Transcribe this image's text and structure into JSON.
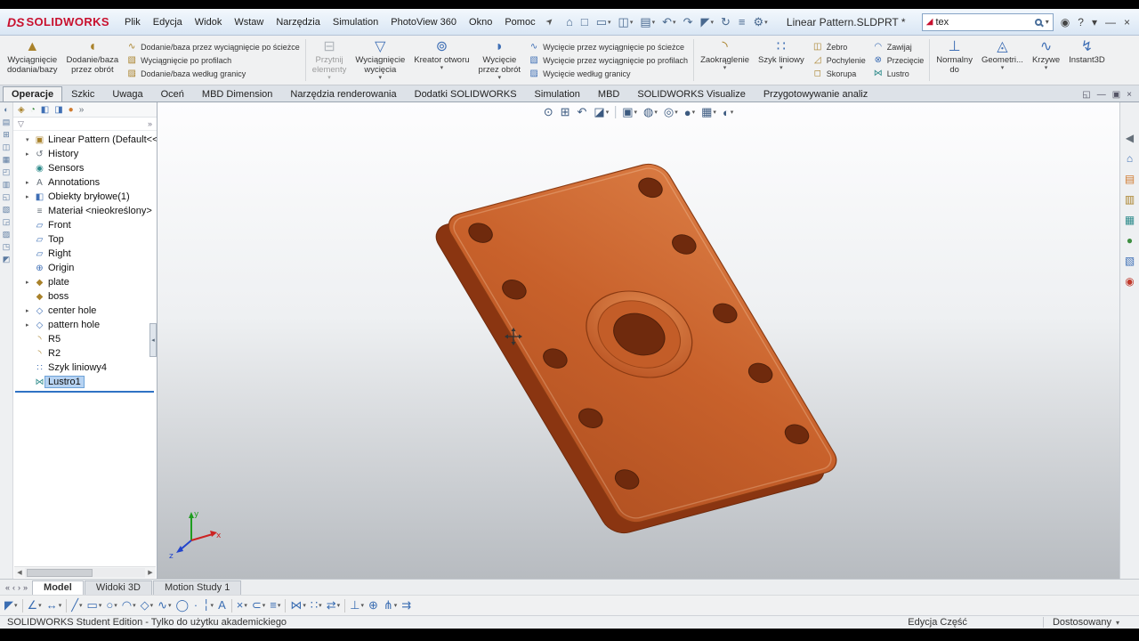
{
  "chrome": {
    "logo_mark": "DS",
    "brand": "SOLIDWORKS",
    "title": "Linear Pattern.SLDPRT *",
    "pin_glyph": "➤",
    "menus": [
      {
        "name": "menu-plik",
        "label": "Plik"
      },
      {
        "name": "menu-edycja",
        "label": "Edycja"
      },
      {
        "name": "menu-widok",
        "label": "Widok"
      },
      {
        "name": "menu-wstaw",
        "label": "Wstaw"
      },
      {
        "name": "menu-narzedzia",
        "label": "Narzędzia"
      },
      {
        "name": "menu-simulation",
        "label": "Simulation"
      },
      {
        "name": "menu-photoview-360",
        "label": "PhotoView 360"
      },
      {
        "name": "menu-okno",
        "label": "Okno"
      },
      {
        "name": "menu-pomoc",
        "label": "Pomoc"
      }
    ],
    "quickbar": [
      {
        "name": "home-icon",
        "glyph": "⌂",
        "drop": ""
      },
      {
        "name": "new-document-icon",
        "glyph": "□",
        "drop": ""
      },
      {
        "name": "open-icon",
        "glyph": "▭",
        "drop": "▾"
      },
      {
        "name": "save-icon",
        "glyph": "◫",
        "drop": "▾"
      },
      {
        "name": "print-icon",
        "glyph": "▤",
        "drop": "▾"
      },
      {
        "name": "undo-icon",
        "glyph": "↶",
        "drop": "▾"
      },
      {
        "name": "redo-icon",
        "glyph": "↷",
        "drop": ""
      },
      {
        "name": "select-icon",
        "glyph": "◤",
        "drop": "▾"
      },
      {
        "name": "rebuild-icon",
        "glyph": "↻",
        "drop": ""
      },
      {
        "name": "file-properties-icon",
        "glyph": "≡",
        "drop": ""
      },
      {
        "name": "options-icon",
        "glyph": "⚙",
        "drop": "▾"
      }
    ],
    "search": {
      "value": "tex",
      "logo_glyph": "◢",
      "drop_glyph": "▾"
    },
    "window_icons": [
      {
        "name": "account-icon",
        "glyph": "◉"
      },
      {
        "name": "help-icon",
        "glyph": "?"
      },
      {
        "name": "help-dropdown-icon",
        "glyph": "▾"
      },
      {
        "name": "minimize-icon",
        "glyph": "—"
      },
      {
        "name": "close-icon",
        "glyph": "×"
      }
    ]
  },
  "ribbon": {
    "b1": {
      "label1": "Wyciągnięcie",
      "label2": "dodania/bazy",
      "icon": "▲",
      "drop": ""
    },
    "b2": {
      "label1": "Dodanie/baza",
      "label2": "przez obrót",
      "icon": "◖",
      "drop": ""
    },
    "colA": [
      {
        "name": "swept-boss-button",
        "label": "Dodanie/baza przez wyciągnięcie po ścieżce",
        "icon": "∿",
        "iconcls": "gold"
      },
      {
        "name": "lofted-boss-button",
        "label": "Wyciągnięcie po profilach",
        "icon": "▧",
        "iconcls": "gold"
      },
      {
        "name": "boundary-boss-button",
        "label": "Dodanie/baza według granicy",
        "icon": "▨",
        "iconcls": "gold"
      }
    ],
    "b3": {
      "label1": "Przytnij",
      "label2": "elementy",
      "icon": "⊟",
      "drop": "▾"
    },
    "b4": {
      "label1": "Wyciągnięcie",
      "label2": "wycięcia",
      "icon": "▽",
      "drop": "▾"
    },
    "b5": {
      "label1": "Kreator otworu",
      "label2": "",
      "icon": "⊚",
      "drop": "▾"
    },
    "b6": {
      "label1": "Wycięcie",
      "label2": "przez obrót",
      "icon": "◗",
      "drop": "▾"
    },
    "colB": [
      {
        "name": "swept-cut-button",
        "label": "Wycięcie przez wyciągnięcie po ścieżce",
        "icon": "∿",
        "iconcls": "blue"
      },
      {
        "name": "lofted-cut-button",
        "label": "Wycięcie przez wyciągnięcie po profilach",
        "icon": "▧",
        "iconcls": "blue"
      },
      {
        "name": "boundary-cut-button",
        "label": "Wycięcie według granicy",
        "icon": "▨",
        "iconcls": "blue"
      }
    ],
    "b7": {
      "label1": "Zaokrąglenie",
      "label2": "",
      "icon": "◝",
      "drop": "▾"
    },
    "b8": {
      "label1": "Szyk liniowy",
      "label2": "",
      "icon": "∷",
      "drop": "▾"
    },
    "colC": [
      {
        "name": "rib-button",
        "label": "Żebro",
        "icon": "◫",
        "iconcls": "gold"
      },
      {
        "name": "draft-button",
        "label": "Pochylenie",
        "icon": "◿",
        "iconcls": "gold"
      },
      {
        "name": "shell-button",
        "label": "Skorupa",
        "icon": "◻",
        "iconcls": "gold"
      }
    ],
    "colD": [
      {
        "name": "wrap-button",
        "label": "Zawijaj",
        "icon": "◠",
        "iconcls": "blue"
      },
      {
        "name": "intersect-button",
        "label": "Przecięcie",
        "icon": "⊗",
        "iconcls": "blue"
      },
      {
        "name": "mirror-button",
        "label": "Lustro",
        "icon": "⋈",
        "iconcls": "teal"
      }
    ],
    "b9": {
      "label1": "Normalny",
      "label2": "do",
      "icon": "⊥",
      "drop": ""
    },
    "b10": {
      "label1": "Geometri...",
      "label2": "",
      "icon": "◬",
      "drop": "▾"
    },
    "b11": {
      "label1": "Krzywe",
      "label2": "",
      "icon": "∿",
      "drop": "▾"
    },
    "b12": {
      "label1": "Instant3D",
      "label2": "",
      "icon": "↯",
      "drop": ""
    }
  },
  "tabs": [
    {
      "name": "tab-operacje",
      "label": "Operacje",
      "cls": "active"
    },
    {
      "name": "tab-szkic",
      "label": "Szkic"
    },
    {
      "name": "tab-uwaga",
      "label": "Uwaga"
    },
    {
      "name": "tab-ocen",
      "label": "Oceń"
    },
    {
      "name": "tab-mbd-dimension",
      "label": "MBD Dimension"
    },
    {
      "name": "tab-narzedzia-renderowania",
      "label": "Narzędzia renderowania"
    },
    {
      "name": "tab-dodatki-solidworks",
      "label": "Dodatki SOLIDWORKS"
    },
    {
      "name": "tab-simulation",
      "label": "Simulation"
    },
    {
      "name": "tab-mbd",
      "label": "MBD"
    },
    {
      "name": "tab-solidworks-visualize",
      "label": "SOLIDWORKS Visualize"
    },
    {
      "name": "tab-przygotowywanie-analiz",
      "label": "Przygotowywanie analiz"
    }
  ],
  "tabrow_icons": [
    {
      "name": "restore-document-icon",
      "glyph": "◱"
    },
    {
      "name": "minimize-document-icon",
      "glyph": "—"
    },
    {
      "name": "maximize-document-icon",
      "glyph": "▣"
    },
    {
      "name": "close-document-icon",
      "glyph": "×"
    }
  ],
  "left_dock": [
    {
      "name": "dock-tool-icon",
      "glyph": "◐"
    },
    {
      "name": "dock-tool-icon",
      "glyph": "▤"
    },
    {
      "name": "dock-tool-icon",
      "glyph": "⊞"
    },
    {
      "name": "dock-tool-icon",
      "glyph": "◫"
    },
    {
      "name": "dock-tool-icon",
      "glyph": "▦"
    },
    {
      "name": "dock-tool-icon",
      "glyph": "◰"
    },
    {
      "name": "dock-tool-icon",
      "glyph": "▥"
    },
    {
      "name": "dock-tool-icon",
      "glyph": "◱"
    },
    {
      "name": "dock-tool-icon",
      "glyph": "▧"
    },
    {
      "name": "dock-tool-icon",
      "glyph": "◲"
    },
    {
      "name": "dock-tool-icon",
      "glyph": "▨"
    },
    {
      "name": "dock-tool-icon",
      "glyph": "◳"
    },
    {
      "name": "dock-tool-icon",
      "glyph": "◩"
    }
  ],
  "tree_header": {
    "tabs": [
      {
        "name": "featuremanager-tab-icon",
        "glyph": "◈",
        "iconcls": "gold"
      },
      {
        "name": "propertymanager-tab-icon",
        "glyph": "◔",
        "iconcls": "green"
      },
      {
        "name": "configurationmanager-tab-icon",
        "glyph": "◧",
        "iconcls": "blue"
      },
      {
        "name": "dimxpertmanager-tab-icon",
        "glyph": "◨",
        "iconcls": "blue"
      },
      {
        "name": "displaymanager-tab-icon",
        "glyph": "●",
        "iconcls": "orange"
      },
      {
        "name": "expand-tabs-icon",
        "glyph": "»",
        "iconcls": "gray"
      }
    ],
    "filter_glyph": "▽",
    "filter_more_glyph": "»"
  },
  "tree_items": [
    {
      "name": "tree-item-root",
      "label": "Linear Pattern (Default<<D",
      "glyph": "▣",
      "iconcls": "gold",
      "exp": "▾",
      "cls": ""
    },
    {
      "name": "tree-item-history",
      "label": "History",
      "glyph": "↺",
      "iconcls": "gray",
      "exp": "▸"
    },
    {
      "name": "tree-item-sensors",
      "label": "Sensors",
      "glyph": "◉",
      "iconcls": "teal",
      "exp": ""
    },
    {
      "name": "tree-item-annotations",
      "label": "Annotations",
      "glyph": "A",
      "iconcls": "gray",
      "exp": "▸"
    },
    {
      "name": "tree-item-solid-bodies",
      "label": "Obiekty bryłowe(1)",
      "glyph": "◧",
      "iconcls": "blue",
      "exp": "▸"
    },
    {
      "name": "tree-item-material",
      "label": "Materiał <nieokreślony>",
      "glyph": "≡",
      "iconcls": "gray",
      "exp": ""
    },
    {
      "name": "tree-item-front-plane",
      "label": "Front",
      "glyph": "▱",
      "iconcls": "blue",
      "exp": ""
    },
    {
      "name": "tree-item-top-plane",
      "label": "Top",
      "glyph": "▱",
      "iconcls": "blue",
      "exp": ""
    },
    {
      "name": "tree-item-right-plane",
      "label": "Right",
      "glyph": "▱",
      "iconcls": "blue",
      "exp": ""
    },
    {
      "name": "tree-item-origin",
      "label": "Origin",
      "glyph": "⊕",
      "iconcls": "blue",
      "exp": ""
    },
    {
      "name": "tree-item-plate",
      "label": "plate",
      "glyph": "◆",
      "iconcls": "gold",
      "exp": "▸"
    },
    {
      "name": "tree-item-boss",
      "label": "boss",
      "glyph": "◆",
      "iconcls": "gold",
      "exp": ""
    },
    {
      "name": "tree-item-center-hole",
      "label": "center hole",
      "glyph": "◇",
      "iconcls": "blue",
      "exp": "▸"
    },
    {
      "name": "tree-item-pattern-hole",
      "label": "pattern hole",
      "glyph": "◇",
      "iconcls": "blue",
      "exp": "▸"
    },
    {
      "name": "tree-item-r5",
      "label": "R5",
      "glyph": "◝",
      "iconcls": "gold",
      "exp": ""
    },
    {
      "name": "tree-item-r2",
      "label": "R2",
      "glyph": "◝",
      "iconcls": "gold",
      "exp": ""
    },
    {
      "name": "tree-item-szyk-liniowy4",
      "label": "Szyk liniowy4",
      "glyph": "∷",
      "iconcls": "blue",
      "exp": ""
    },
    {
      "name": "tree-item-lustro1",
      "label": "Lustro1",
      "glyph": "⋈",
      "iconcls": "teal",
      "exp": "",
      "cls": "selected"
    }
  ],
  "tree_scroll": {
    "left": "◀",
    "right": "▶"
  },
  "panel_collapse_glyph": "◂",
  "viewport": {
    "hud": [
      {
        "name": "zoom-fit-icon",
        "glyph": "⊙",
        "drop": ""
      },
      {
        "name": "zoom-area-icon",
        "glyph": "⊞",
        "drop": ""
      },
      {
        "name": "previous-view-icon",
        "glyph": "↶",
        "drop": ""
      },
      {
        "name": "section-view-icon",
        "glyph": "◪",
        "drop": "▾"
      },
      {
        "name": "hud-separator",
        "glyph": "",
        "cls": "sep"
      },
      {
        "name": "view-orientation-icon",
        "glyph": "▣",
        "drop": "▾"
      },
      {
        "name": "display-style-icon",
        "glyph": "◍",
        "drop": "▾"
      },
      {
        "name": "hide-show-items-icon",
        "glyph": "◎",
        "drop": "▾"
      },
      {
        "name": "edit-appearance-icon",
        "glyph": "●",
        "drop": "▾"
      },
      {
        "name": "apply-scene-icon",
        "glyph": "▦",
        "drop": "▾"
      },
      {
        "name": "view-settings-icon",
        "glyph": "◐",
        "drop": "▾"
      }
    ],
    "triad": {
      "x": "x",
      "y": "y",
      "z": "z"
    },
    "part_colors": {
      "face": "#c8612b",
      "face_light": "#d97a42",
      "face_dark": "#b35222",
      "side": "#8a3511",
      "hole": "#6f2a0d",
      "edge": "#8a3a12"
    }
  },
  "taskpane": [
    {
      "name": "collapse-taskpane-icon",
      "glyph": "◀",
      "iconcls": "gray"
    },
    {
      "name": "resources-icon",
      "glyph": "⌂",
      "iconcls": "blue"
    },
    {
      "name": "design-library-icon",
      "glyph": "▤",
      "iconcls": "orange"
    },
    {
      "name": "file-explorer-icon",
      "glyph": "▥",
      "iconcls": "gold"
    },
    {
      "name": "view-palette-icon",
      "glyph": "▦",
      "iconcls": "teal"
    },
    {
      "name": "appearances-icon",
      "glyph": "●",
      "iconcls": "green"
    },
    {
      "name": "custom-properties-icon",
      "glyph": "▧",
      "iconcls": "blue"
    },
    {
      "name": "forum-icon",
      "glyph": "◉",
      "iconcls": "red"
    }
  ],
  "doc_tabs": {
    "nav": [
      {
        "name": "scroll-first-icon",
        "glyph": "«"
      },
      {
        "name": "scroll-prev-icon",
        "glyph": "‹"
      },
      {
        "name": "scroll-next-icon",
        "glyph": "›"
      },
      {
        "name": "scroll-last-icon",
        "glyph": "»"
      }
    ],
    "tabs": [
      {
        "name": "tab-model",
        "label": "Model",
        "cls": "active"
      },
      {
        "name": "tab-widoki-3d",
        "label": "Widoki 3D",
        "cls": ""
      },
      {
        "name": "tab-motion-study-1",
        "label": "Motion Study 1",
        "cls": ""
      }
    ]
  },
  "sketch_tools": [
    {
      "name": "select-tool-icon",
      "glyph": "◤",
      "drop": "▾"
    },
    {
      "name": "toolbar-separator",
      "glyph": "",
      "cls": "sep"
    },
    {
      "name": "sketch-icon",
      "glyph": "∠",
      "drop": "▾"
    },
    {
      "name": "smart-dimension-icon",
      "glyph": "↔",
      "drop": "▾"
    },
    {
      "name": "toolbar-separator",
      "glyph": "",
      "cls": "sep"
    },
    {
      "name": "line-icon",
      "glyph": "╱",
      "drop": "▾"
    },
    {
      "name": "rectangle-icon",
      "glyph": "▭",
      "drop": "▾"
    },
    {
      "name": "circle-icon",
      "glyph": "○",
      "drop": "▾"
    },
    {
      "name": "arc-icon",
      "glyph": "◠",
      "drop": "▾"
    },
    {
      "name": "polygon-icon",
      "glyph": "◇",
      "drop": "▾"
    },
    {
      "name": "spline-icon",
      "glyph": "∿",
      "drop": "▾"
    },
    {
      "name": "ellipse-icon",
      "glyph": "◯",
      "drop": ""
    },
    {
      "name": "point-icon",
      "glyph": "∙",
      "drop": ""
    },
    {
      "name": "centerline-icon",
      "glyph": "╎",
      "drop": "▾"
    },
    {
      "name": "text-icon",
      "glyph": "A",
      "drop": ""
    },
    {
      "name": "toolbar-separator",
      "glyph": "",
      "cls": "sep"
    },
    {
      "name": "trim-entities-icon",
      "glyph": "×",
      "drop": "▾"
    },
    {
      "name": "convert-entities-icon",
      "glyph": "⊂",
      "drop": "▾"
    },
    {
      "name": "offset-entities-icon",
      "glyph": "≡",
      "drop": "▾"
    },
    {
      "name": "toolbar-separator",
      "glyph": "",
      "cls": "sep"
    },
    {
      "name": "mirror-entities-icon",
      "glyph": "⋈",
      "drop": "▾"
    },
    {
      "name": "linear-sketch-pattern-icon",
      "glyph": "∷",
      "drop": "▾"
    },
    {
      "name": "move-entities-icon",
      "glyph": "⇄",
      "drop": "▾"
    },
    {
      "name": "toolbar-separator",
      "glyph": "",
      "cls": "sep"
    },
    {
      "name": "display-relations-icon",
      "glyph": "⊥",
      "drop": "▾"
    },
    {
      "name": "repair-sketch-icon",
      "glyph": "⊕",
      "drop": ""
    },
    {
      "name": "quick-snaps-icon",
      "glyph": "⋔",
      "drop": "▾"
    },
    {
      "name": "rapid-sketch-icon",
      "glyph": "⇉",
      "drop": ""
    }
  ],
  "status": {
    "left": "SOLIDWORKS Student Edition - Tylko do użytku akademickiego",
    "mode": "Edycja Część",
    "custom": "Dostosowany",
    "custom_arrow": "▾"
  }
}
